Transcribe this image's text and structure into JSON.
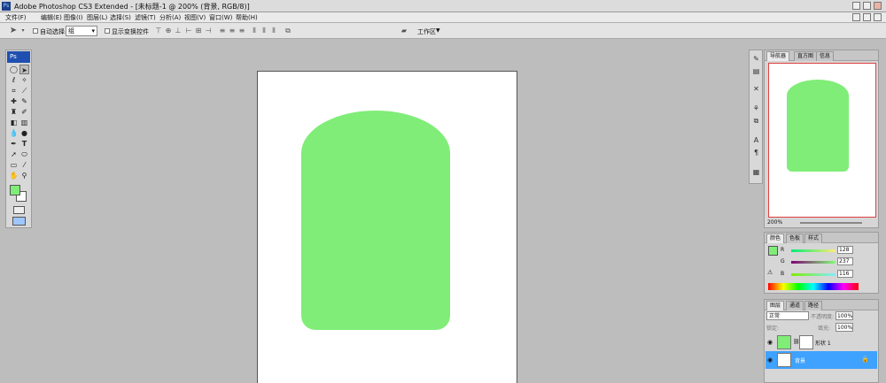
{
  "window": {
    "title": "Adobe Photoshop CS3 Extended - [未标题-1 @ 200% (背景, RGB/8)]",
    "app_icon": "Ps"
  },
  "menu": [
    "文件(F)",
    "编辑(E)",
    "图像(I)",
    "图层(L)",
    "选择(S)",
    "滤镜(T)",
    "分析(A)",
    "视图(V)",
    "窗口(W)",
    "帮助(H)"
  ],
  "options": {
    "auto_select_label": "自动选择:",
    "auto_select_value": "组",
    "show_transform_label": "显示变换控件",
    "workspace_label": "工作区"
  },
  "toolbox": {
    "logo": "Ps",
    "tools": [
      "marquee-icon",
      "move-icon",
      "lasso-icon",
      "magic-wand-icon",
      "crop-icon",
      "slice-icon",
      "healing-icon",
      "brush-icon",
      "stamp-icon",
      "history-brush-icon",
      "eraser-icon",
      "gradient-icon",
      "blur-icon",
      "dodge-icon",
      "pen-icon",
      "type-icon",
      "path-select-icon",
      "shape-icon",
      "notes-icon",
      "eyedropper-icon",
      "hand-icon",
      "zoom-icon"
    ],
    "foreground_color": "#80ed78",
    "background_color": "#ffffff"
  },
  "document": {
    "canvas_color": "#ffffff",
    "shape_color": "#80ed78"
  },
  "navigator": {
    "tabs": [
      "导航器",
      "直方图",
      "信息"
    ],
    "zoom": "200%"
  },
  "color_panel": {
    "tabs": [
      "颜色",
      "色板",
      "样式"
    ],
    "r_label": "R",
    "g_label": "G",
    "b_label": "B",
    "r": "128",
    "g": "237",
    "b": "116"
  },
  "layers_panel": {
    "tabs": [
      "图层",
      "通道",
      "路径"
    ],
    "blend_mode": "正常",
    "opacity_label": "不透明度:",
    "opacity": "100%",
    "lock_label": "锁定:",
    "fill_label": "填充:",
    "fill": "100%",
    "layers": [
      {
        "name": "形状 1",
        "selected": false
      },
      {
        "name": "背景",
        "selected": true
      }
    ]
  }
}
